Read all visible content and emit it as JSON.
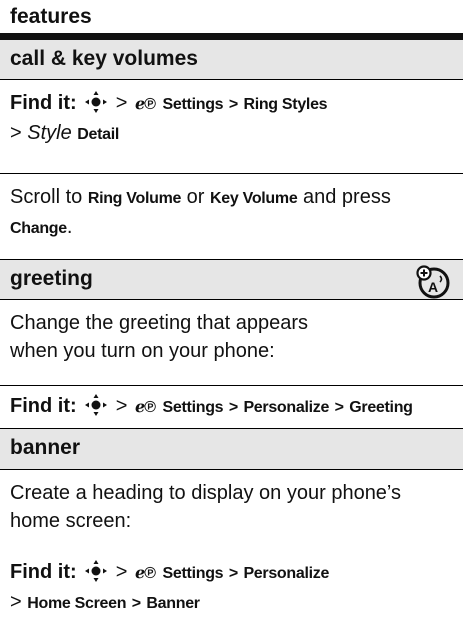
{
  "header": {
    "title": "features"
  },
  "sections": [
    {
      "title": "call & key volumes",
      "find_label": "Find it:",
      "path_line1": [
        "Settings",
        ">",
        "Ring Styles"
      ],
      "path_line2_prefix": ">",
      "path_line2_italic": "Style",
      "path_line2_bold": "Detail",
      "body_parts": [
        "Scroll to",
        "Ring Volume",
        "or",
        "Key Volume",
        "and press",
        "Change",
        "."
      ]
    },
    {
      "title": "greeting",
      "icon": "personalize-icon",
      "body": "Change the greeting that appears",
      "body2": "when you turn on your phone:",
      "find_label": "Find it:",
      "path": [
        "Settings",
        ">",
        "Personalize",
        ">",
        "Greeting"
      ]
    },
    {
      "title": "banner",
      "body": "Create a heading to display on your phone’s",
      "body2": "home screen:",
      "find_label": "Find it:",
      "path_line1": [
        "Settings",
        ">",
        "Personalize"
      ],
      "path_line2": [
        ">",
        "Home Screen",
        ">",
        "Banner"
      ]
    }
  ],
  "symbols": {
    "gt": ">"
  }
}
